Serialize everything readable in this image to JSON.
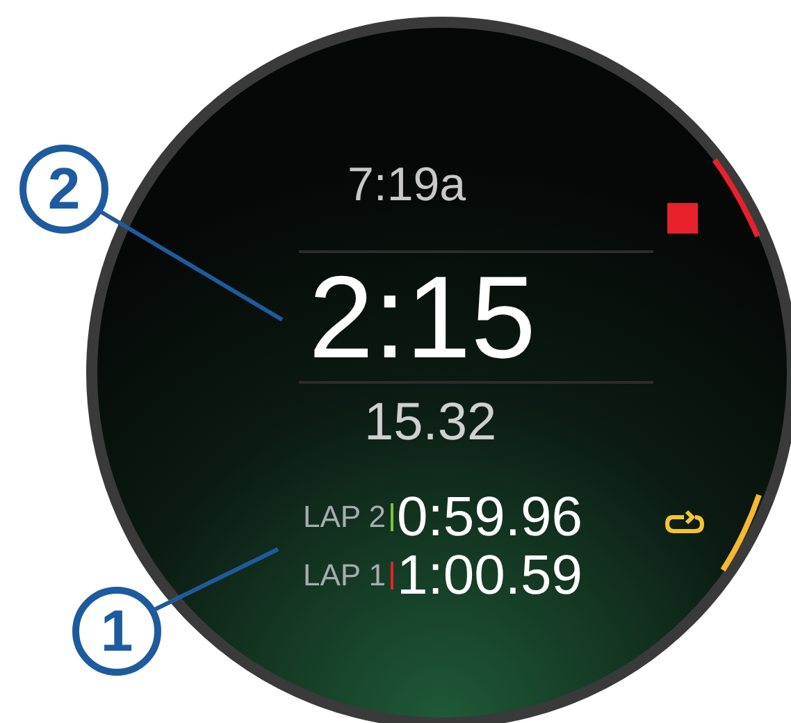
{
  "watch": {
    "time_of_day": "7:19a",
    "timer": "2:15",
    "distance": "15.32",
    "laps": [
      {
        "label": "LAP 2",
        "time": "0:59.96",
        "color": "#7cc242"
      },
      {
        "label": "LAP 1",
        "time": "1:00.59",
        "color": "#e8212b"
      }
    ]
  },
  "callouts": [
    {
      "label": "2"
    },
    {
      "label": "1"
    }
  ]
}
